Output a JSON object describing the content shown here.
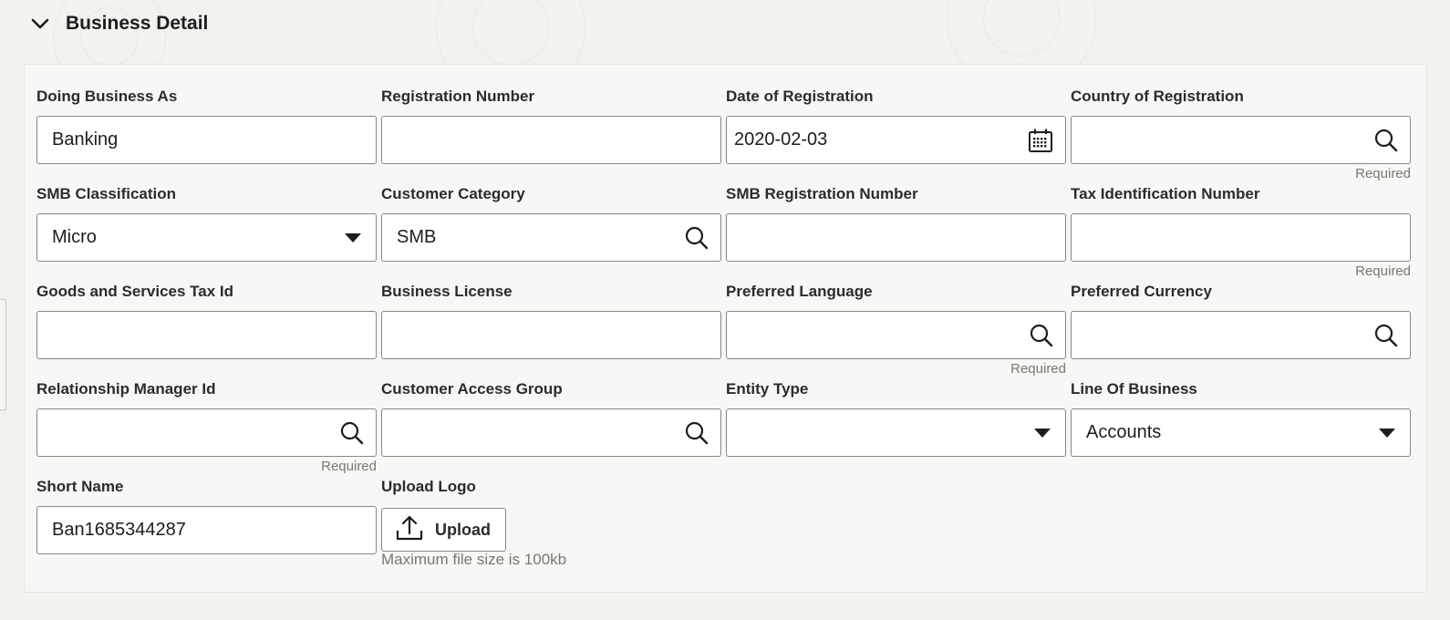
{
  "section": {
    "title": "Business Detail",
    "toggle_icon": "chevron-down-icon"
  },
  "fields": {
    "doing_business_as": {
      "label": "Doing Business As",
      "value": "Banking"
    },
    "registration_number": {
      "label": "Registration Number",
      "value": ""
    },
    "date_of_registration": {
      "label": "Date of Registration",
      "value": "2020-02-03",
      "icon": "calendar-icon"
    },
    "country_of_registration": {
      "label": "Country of Registration",
      "value": "",
      "icon": "search-icon",
      "hint": "Required"
    },
    "smb_classification": {
      "label": "SMB Classification",
      "value": "Micro",
      "icon": "dropdown-caret-icon"
    },
    "customer_category": {
      "label": "Customer Category",
      "value": "SMB",
      "icon": "search-icon"
    },
    "smb_registration_number": {
      "label": "SMB Registration Number",
      "value": ""
    },
    "tax_identification_number": {
      "label": "Tax Identification Number",
      "value": "",
      "hint": "Required"
    },
    "goods_and_services_tax_id": {
      "label": "Goods and Services Tax Id",
      "value": ""
    },
    "business_license": {
      "label": "Business License",
      "value": ""
    },
    "preferred_language": {
      "label": "Preferred Language",
      "value": "",
      "icon": "search-icon",
      "hint": "Required"
    },
    "preferred_currency": {
      "label": "Preferred Currency",
      "value": "",
      "icon": "search-icon"
    },
    "relationship_manager_id": {
      "label": "Relationship Manager Id",
      "value": "",
      "icon": "search-icon",
      "hint": "Required"
    },
    "customer_access_group": {
      "label": "Customer Access Group",
      "value": "",
      "icon": "search-icon"
    },
    "entity_type": {
      "label": "Entity Type",
      "value": "",
      "icon": "dropdown-caret-icon"
    },
    "line_of_business": {
      "label": "Line Of Business",
      "value": "Accounts",
      "icon": "dropdown-caret-icon"
    },
    "short_name": {
      "label": "Short Name",
      "value": "Ban1685344287"
    }
  },
  "upload": {
    "label": "Upload Logo",
    "button_label": "Upload",
    "button_icon": "upload-icon",
    "hint": "Maximum file size is 100kb"
  },
  "colors": {
    "page_bg": "#f3f2ef",
    "panel_bg": "#f8f7f5",
    "input_border": "#8a8782",
    "hint_text": "#7a7772"
  }
}
